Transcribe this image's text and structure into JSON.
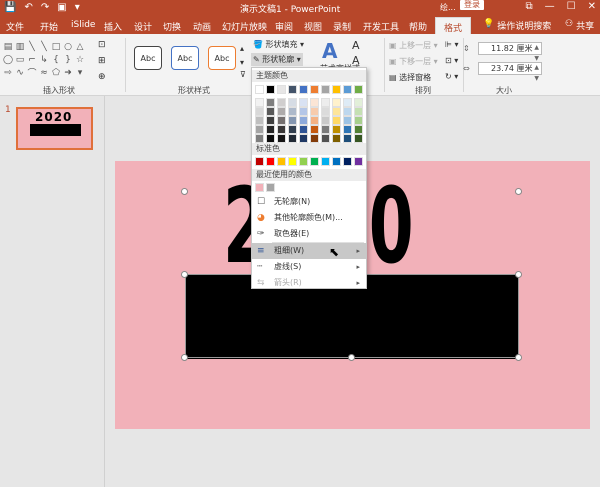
{
  "titlebar": {
    "quick_access": [
      "💾",
      "↶",
      "↷",
      "▣",
      "▾"
    ],
    "title": "演示文稿1 - PowerPoint",
    "user": "绘...",
    "login_label": "登录",
    "window_controls": [
      "⧉",
      "—",
      "☐",
      "✕"
    ]
  },
  "tabs": {
    "items": [
      "文件",
      "开始",
      "iSlide",
      "插入",
      "设计",
      "切换",
      "动画",
      "幻灯片放映",
      "审阅",
      "视图",
      "录制",
      "开发工具",
      "帮助"
    ],
    "active": "格式",
    "search": "操作说明搜索",
    "share": "共享"
  },
  "ribbon": {
    "insert_shapes_label": "插入形状",
    "shape_styles_label": "形状样式",
    "arrange_label": "排列",
    "size_label": "大小",
    "style_boxes": [
      "Abc",
      "Abc",
      "Abc"
    ],
    "shape_fill": "形状填充",
    "shape_outline": "形状轮廓",
    "art_styles": "艺术字样式",
    "bring_forward": "上移一层",
    "send_backward": "下移一层",
    "selection_pane": "选择窗格",
    "height": "11.82 厘米",
    "width": "23.74 厘米"
  },
  "sidebar": {
    "slide_number": "1",
    "thumb_text": "2020"
  },
  "slide": {
    "big_text": "2020"
  },
  "outline_menu": {
    "theme_colors_label": "主题颜色",
    "standard_colors_label": "标准色",
    "recent_colors_label": "最近使用的颜色",
    "no_outline": "无轮廓(N)",
    "more_colors": "其他轮廓颜色(M)...",
    "eyedropper": "取色器(E)",
    "weight": "粗细(W)",
    "dashes": "虚线(S)",
    "arrows": "箭头(R)",
    "theme_top_row": [
      "#ffffff",
      "#000000",
      "#e7e6e6",
      "#44546a",
      "#4472c4",
      "#ed7d31",
      "#a5a5a5",
      "#ffc000",
      "#5b9bd5",
      "#70ad47"
    ],
    "theme_shades": [
      [
        "#f2f2f2",
        "#7f7f7f",
        "#d0cece",
        "#d6dce4",
        "#d9e2f3",
        "#fbe5d5",
        "#ededed",
        "#fff2cc",
        "#deebf6",
        "#e2efd9"
      ],
      [
        "#d8d8d8",
        "#595959",
        "#aeabab",
        "#adb9ca",
        "#b4c6e7",
        "#f7cbac",
        "#dbdbdb",
        "#fee599",
        "#bdd7ee",
        "#c5e0b3"
      ],
      [
        "#bfbfbf",
        "#3f3f3f",
        "#757070",
        "#8496b0",
        "#8eaadb",
        "#f4b183",
        "#c9c9c9",
        "#ffd965",
        "#9cc3e5",
        "#a8d08d"
      ],
      [
        "#a5a5a5",
        "#262626",
        "#3a3838",
        "#323f4f",
        "#2f5496",
        "#c55a11",
        "#7b7b7b",
        "#bf9000",
        "#2e75b5",
        "#538135"
      ],
      [
        "#7f7f7f",
        "#0c0c0c",
        "#171616",
        "#222a35",
        "#1f3864",
        "#833c0b",
        "#525252",
        "#7f6000",
        "#1e4e79",
        "#375623"
      ]
    ],
    "standard": [
      "#c00000",
      "#ff0000",
      "#ffc000",
      "#ffff00",
      "#92d050",
      "#00b050",
      "#00b0f0",
      "#0070c0",
      "#002060",
      "#7030a0"
    ],
    "recent": [
      "#f2b1b9",
      "#a5a5a5"
    ]
  }
}
